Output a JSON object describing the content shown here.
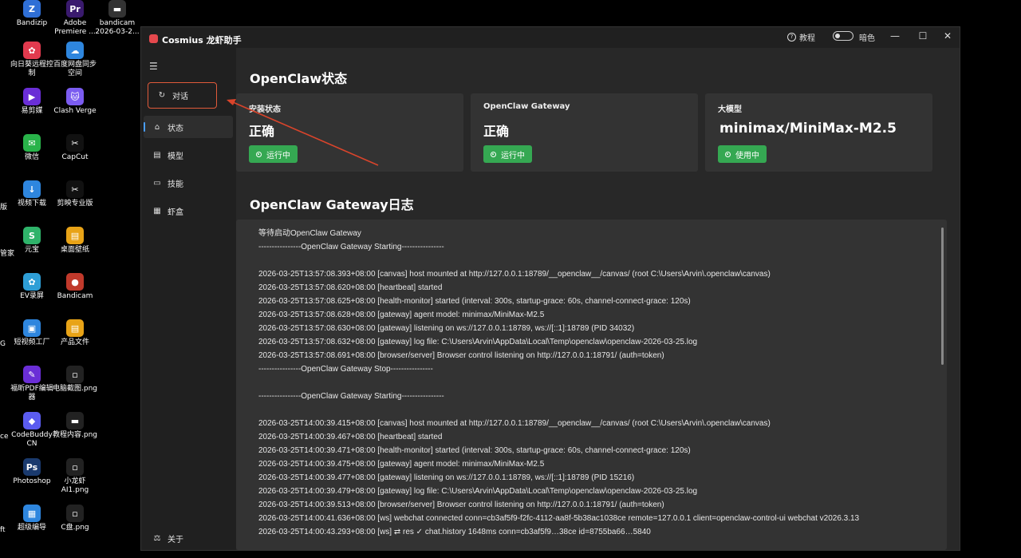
{
  "desktop": {
    "icons": [
      {
        "label": "Bandizip",
        "color": "#2f6fd6",
        "glyph": "Z",
        "icon": "archive-icon"
      },
      {
        "label": "Adobe Premiere ...",
        "color": "#3a1a6e",
        "glyph": "Pr",
        "icon": "premiere-icon"
      },
      {
        "label": "bandicam 2026-03-2...",
        "color": "#333333",
        "glyph": "▬",
        "icon": "video-file-icon"
      },
      {
        "label": "向日葵远程控制",
        "color": "#e23a4e",
        "glyph": "✿",
        "icon": "sunflower-icon"
      },
      {
        "label": "百度网盘同步空间",
        "color": "#2e86de",
        "glyph": "☁",
        "icon": "cloud-icon"
      },
      {
        "label": "易剪媒",
        "color": "#6a2ed6",
        "glyph": "▶",
        "icon": "editor-icon"
      },
      {
        "label": "Clash Verge",
        "color": "#7b5cf0",
        "glyph": "🐱",
        "icon": "cat-icon"
      },
      {
        "label": "微信",
        "color": "#29b34a",
        "glyph": "✉",
        "icon": "wechat-icon"
      },
      {
        "label": "CapCut",
        "color": "#111111",
        "glyph": "✂",
        "icon": "capcut-icon"
      },
      {
        "label": "视频下载",
        "color": "#2e86de",
        "glyph": "↓",
        "icon": "download-icon"
      },
      {
        "label": "剪映专业版",
        "color": "#111111",
        "glyph": "✂",
        "icon": "jianying-icon"
      },
      {
        "label": "元宝",
        "color": "#2fb36a",
        "glyph": "S",
        "icon": "yuanbao-icon"
      },
      {
        "label": "桌面壁纸",
        "color": "#e8a317",
        "glyph": "▤",
        "icon": "folder-icon"
      },
      {
        "label": "EV录屏",
        "color": "#2e9ed6",
        "glyph": "✿",
        "icon": "recorder-icon"
      },
      {
        "label": "Bandicam",
        "color": "#c0392b",
        "glyph": "●",
        "icon": "bandicam-icon"
      },
      {
        "label": "短视频工厂",
        "color": "#2e86de",
        "glyph": "▣",
        "icon": "factory-icon"
      },
      {
        "label": "产品文件",
        "color": "#e8a317",
        "glyph": "▤",
        "icon": "folder-icon"
      },
      {
        "label": "福昕PDF编辑器",
        "color": "#6a2ed6",
        "glyph": "✎",
        "icon": "pdf-icon"
      },
      {
        "label": "电脑截图.png",
        "color": "#222222",
        "glyph": "▫",
        "icon": "image-file-icon"
      },
      {
        "label": "CodeBuddy CN",
        "color": "#5b5cf0",
        "glyph": "◆",
        "icon": "codebuddy-icon"
      },
      {
        "label": "教程内容.png",
        "color": "#222222",
        "glyph": "▬",
        "icon": "image-file-icon"
      },
      {
        "label": "Photoshop",
        "color": "#1a3a6e",
        "glyph": "Ps",
        "icon": "photoshop-icon"
      },
      {
        "label": "小龙虾AI1.png",
        "color": "#222222",
        "glyph": "▫",
        "icon": "image-file-icon"
      },
      {
        "label": "超级编导",
        "color": "#2e86de",
        "glyph": "▦",
        "icon": "director-icon"
      },
      {
        "label": "C盘.png",
        "color": "#222222",
        "glyph": "▫",
        "icon": "image-file-icon"
      }
    ],
    "cut_labels": [
      "版",
      "管家",
      "G",
      "ce",
      "ft"
    ]
  },
  "window": {
    "title": "Cosmius 龙虾助手",
    "help_label": "教程",
    "help_icon_glyph": "?",
    "dark_label": "暗色",
    "min_glyph": "—",
    "max_glyph": "☐",
    "close_glyph": "✕"
  },
  "sidebar": {
    "menu_glyph": "☰",
    "items": [
      {
        "label": "对话",
        "glyph": "↻",
        "icon": "chat-refresh-icon"
      },
      {
        "label": "状态",
        "glyph": "⌂",
        "icon": "home-icon"
      },
      {
        "label": "模型",
        "glyph": "▤",
        "icon": "model-icon"
      },
      {
        "label": "技能",
        "glyph": "▭",
        "icon": "skills-icon"
      },
      {
        "label": "虾盒",
        "glyph": "▦",
        "icon": "box-icon"
      }
    ],
    "about": {
      "label": "关于",
      "glyph": "⚖",
      "icon": "about-icon"
    }
  },
  "status": {
    "title": "OpenClaw状态",
    "cards": [
      {
        "label": "安装状态",
        "value": "正确",
        "badge": "运行中"
      },
      {
        "label": "OpenClaw Gateway",
        "value": "正确",
        "badge": "运行中"
      },
      {
        "label": "大模型",
        "value": "minimax/MiniMax-M2.5",
        "badge": "使用中"
      }
    ]
  },
  "log": {
    "title": "OpenClaw Gateway日志",
    "lines": [
      "等待启动OpenClaw Gateway",
      "----------------OpenClaw Gateway Starting----------------",
      "",
      "2026-03-25T13:57:08.393+08:00 [canvas] host mounted at http://127.0.0.1:18789/__openclaw__/canvas/ (root C:\\Users\\Arvin\\.openclaw\\canvas)",
      "2026-03-25T13:57:08.620+08:00 [heartbeat] started",
      "2026-03-25T13:57:08.625+08:00 [health-monitor] started (interval: 300s, startup-grace: 60s, channel-connect-grace: 120s)",
      "2026-03-25T13:57:08.628+08:00 [gateway] agent model: minimax/MiniMax-M2.5",
      "2026-03-25T13:57:08.630+08:00 [gateway] listening on ws://127.0.0.1:18789, ws://[::1]:18789 (PID 34032)",
      "2026-03-25T13:57:08.632+08:00 [gateway] log file: C:\\Users\\Arvin\\AppData\\Local\\Temp\\openclaw\\openclaw-2026-03-25.log",
      "2026-03-25T13:57:08.691+08:00 [browser/server] Browser control listening on http://127.0.0.1:18791/ (auth=token)",
      "----------------OpenClaw Gateway Stop----------------",
      "",
      "----------------OpenClaw Gateway Starting----------------",
      "",
      "2026-03-25T14:00:39.415+08:00 [canvas] host mounted at http://127.0.0.1:18789/__openclaw__/canvas/ (root C:\\Users\\Arvin\\.openclaw\\canvas)",
      "2026-03-25T14:00:39.467+08:00 [heartbeat] started",
      "2026-03-25T14:00:39.471+08:00 [health-monitor] started (interval: 300s, startup-grace: 60s, channel-connect-grace: 120s)",
      "2026-03-25T14:00:39.475+08:00 [gateway] agent model: minimax/MiniMax-M2.5",
      "2026-03-25T14:00:39.477+08:00 [gateway] listening on ws://127.0.0.1:18789, ws://[::1]:18789 (PID 15216)",
      "2026-03-25T14:00:39.479+08:00 [gateway] log file: C:\\Users\\Arvin\\AppData\\Local\\Temp\\openclaw\\openclaw-2026-03-25.log",
      "2026-03-25T14:00:39.513+08:00 [browser/server] Browser control listening on http://127.0.0.1:18791/ (auth=token)",
      "2026-03-25T14:00:41.636+08:00 [ws] webchat connected conn=cb3af5f9-f2fc-4112-aa8f-5b38ac1038ce remote=127.0.0.1 client=openclaw-control-ui webchat v2026.3.13",
      "2026-03-25T14:00:43.293+08:00 [ws] ⇄ res ✓ chat.history 1648ms conn=cb3af5f9…38ce id=8755ba66…5840"
    ]
  },
  "colors": {
    "accent": "#4a9eff",
    "success": "#35a852",
    "highlight": "#e05a3a"
  }
}
